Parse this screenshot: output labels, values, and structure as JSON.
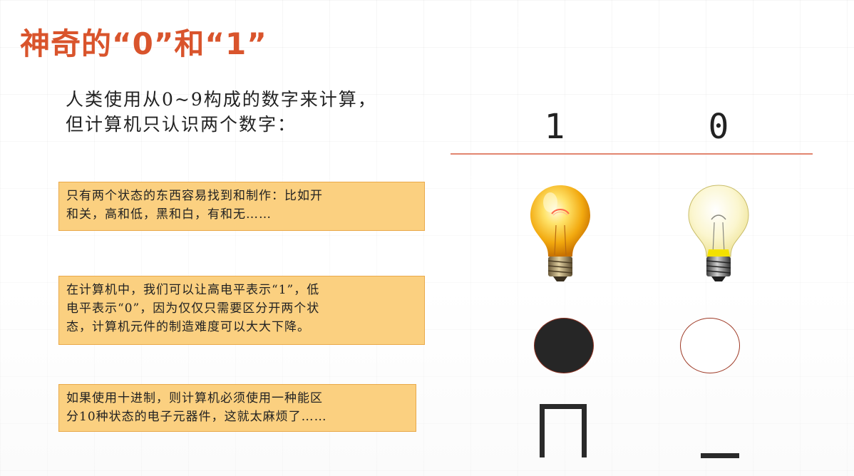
{
  "slide": {
    "title": "神奇的“0”和“1”",
    "intro_lines": [
      "人类使用从0~9构成的数字来计算，",
      "但计算机只认识两个数字："
    ],
    "boxes": [
      {
        "lines": [
          "只有两个状态的东西容易找到和制作：比如开",
          "和关，高和低，黑和白，有和无……"
        ]
      },
      {
        "lines": [
          "在计算机中，我们可以让高电平表示“1”，低",
          "电平表示“0”，因为仅仅只需要区分开两个状",
          "态，计算机元件的制造难度可以大大下降。"
        ]
      },
      {
        "lines": [
          "如果使用十进制，则计算机必须使用一种能区",
          "分10种状态的电子元器件，这就太麻烦了……"
        ]
      }
    ],
    "digits": {
      "one": "1",
      "zero": "0"
    },
    "colors": {
      "title": "#d9542c",
      "box_fill": "#fbd080",
      "box_border": "#e9a94a",
      "rule": "#e2856f"
    },
    "icons": {
      "bulb_on": "lit-light-bulb",
      "bulb_off": "unlit-light-bulb",
      "circle_black": "filled-black-circle",
      "circle_white": "hollow-white-circle",
      "signal_high": "high-level-square-pulse",
      "signal_low": "low-level-line"
    }
  }
}
